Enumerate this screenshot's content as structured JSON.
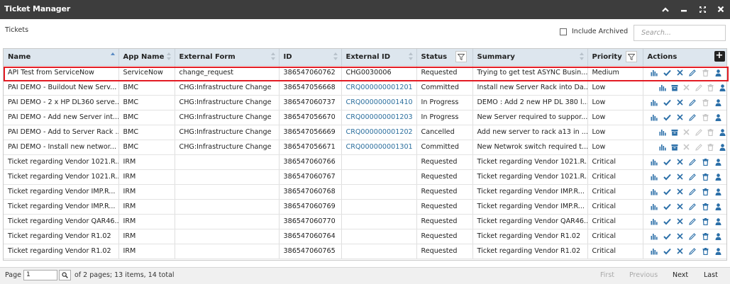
{
  "window": {
    "title": "Ticket Manager"
  },
  "section": {
    "label": "Tickets"
  },
  "toolbar": {
    "include_archived_label": "Include Archived",
    "include_archived_checked": false,
    "search_placeholder": "Search..."
  },
  "columns": [
    "Name",
    "App Name",
    "External Form",
    "ID",
    "External ID",
    "Status",
    "Summary",
    "Priority",
    "Actions"
  ],
  "rows": [
    {
      "name": "API Test from ServiceNow",
      "app": "ServiceNow",
      "form": "change_request",
      "id": "386547060762",
      "ext_id": "CHG0030006",
      "status": "Requested",
      "summary": "Trying to get test ASYNC Busin...",
      "priority": "Medium",
      "icons": [
        "chart",
        "check",
        "x",
        "pencil",
        "trash-disabled",
        "user"
      ]
    },
    {
      "name": "PAI DEMO - Buildout New Serv...",
      "app": "BMC",
      "form": "CHG:Infrastructure Change",
      "id": "386547056668",
      "ext_id": "CRQ000000001201",
      "status": "Committed",
      "summary": "Install new Server Rack into Da...",
      "priority": "Low",
      "icons": [
        "chart",
        "archive",
        "x-disabled",
        "pencil-disabled",
        "trash-disabled",
        "user"
      ]
    },
    {
      "name": "PAI DEMO - 2 x HP DL360 serve...",
      "app": "BMC",
      "form": "CHG:Infrastructure Change",
      "id": "386547060737",
      "ext_id": "CRQ000000001410",
      "status": "In Progress",
      "summary": "DEMO : Add 2 new HP DL 380 l...",
      "priority": "Low",
      "icons": [
        "chart",
        "check",
        "x",
        "pencil",
        "trash-disabled",
        "user"
      ]
    },
    {
      "name": "PAI DEMO - Add new Server int...",
      "app": "BMC",
      "form": "CHG:Infrastructure Change",
      "id": "386547056670",
      "ext_id": "CRQ000000001203",
      "status": "In Progress",
      "summary": "New Server required to suppor...",
      "priority": "Low",
      "icons": [
        "chart",
        "check",
        "x",
        "pencil",
        "trash-disabled",
        "user"
      ]
    },
    {
      "name": "PAI DEMO - Add to Server Rack ...",
      "app": "BMC",
      "form": "CHG:Infrastructure Change",
      "id": "386547056669",
      "ext_id": "CRQ000000001202",
      "status": "Cancelled",
      "summary": "Add new server to rack a13 in ...",
      "priority": "Low",
      "icons": [
        "chart",
        "archive",
        "x-disabled",
        "pencil-disabled",
        "trash-disabled",
        "user"
      ]
    },
    {
      "name": "PAI DEMO - Install new networ...",
      "app": "BMC",
      "form": "CHG:Infrastructure Change",
      "id": "386547056671",
      "ext_id": "CRQ000000001301",
      "status": "Committed",
      "summary": "New Netwrok switch required t...",
      "priority": "Low",
      "icons": [
        "chart",
        "archive",
        "x-disabled",
        "pencil-disabled",
        "trash-disabled",
        "user"
      ]
    },
    {
      "name": "Ticket regarding Vendor 1021.R...",
      "app": "IRM",
      "form": "",
      "id": "386547060766",
      "ext_id": "",
      "status": "Requested",
      "summary": "Ticket regarding Vendor 1021.R...",
      "priority": "Critical",
      "icons": [
        "chart",
        "check",
        "x",
        "pencil",
        "trash",
        "user"
      ]
    },
    {
      "name": "Ticket regarding Vendor 1021.R...",
      "app": "IRM",
      "form": "",
      "id": "386547060767",
      "ext_id": "",
      "status": "Requested",
      "summary": "Ticket regarding Vendor 1021.R...",
      "priority": "Critical",
      "icons": [
        "chart",
        "check",
        "x",
        "pencil",
        "trash",
        "user"
      ]
    },
    {
      "name": "Ticket regarding Vendor IMP.R...",
      "app": "IRM",
      "form": "",
      "id": "386547060768",
      "ext_id": "",
      "status": "Requested",
      "summary": "Ticket regarding Vendor IMP.R...",
      "priority": "Critical",
      "icons": [
        "chart",
        "check",
        "x",
        "pencil",
        "trash",
        "user"
      ]
    },
    {
      "name": "Ticket regarding Vendor IMP.R...",
      "app": "IRM",
      "form": "",
      "id": "386547060769",
      "ext_id": "",
      "status": "Requested",
      "summary": "Ticket regarding Vendor IMP.R...",
      "priority": "Critical",
      "icons": [
        "chart",
        "check",
        "x",
        "pencil",
        "trash",
        "user"
      ]
    },
    {
      "name": "Ticket regarding Vendor QAR46...",
      "app": "IRM",
      "form": "",
      "id": "386547060770",
      "ext_id": "",
      "status": "Requested",
      "summary": "Ticket regarding Vendor QAR46...",
      "priority": "Critical",
      "icons": [
        "chart",
        "check",
        "x",
        "pencil",
        "trash",
        "user"
      ]
    },
    {
      "name": "Ticket regarding Vendor R1.02",
      "app": "IRM",
      "form": "",
      "id": "386547060764",
      "ext_id": "",
      "status": "Requested",
      "summary": "Ticket regarding Vendor R1.02",
      "priority": "Critical",
      "icons": [
        "chart",
        "check",
        "x",
        "pencil",
        "trash",
        "user"
      ]
    },
    {
      "name": "Ticket regarding Vendor R1.02",
      "app": "IRM",
      "form": "",
      "id": "386547060765",
      "ext_id": "",
      "status": "Requested",
      "summary": "Ticket regarding Vendor R1.02",
      "priority": "Critical",
      "icons": [
        "chart",
        "check",
        "x",
        "pencil",
        "trash",
        "user"
      ]
    }
  ],
  "pagination": {
    "page_label": "Page",
    "page_value": "1",
    "info": "of 2 pages; 13 items, 14 total",
    "first": "First",
    "previous": "Previous",
    "next": "Next",
    "last": "Last"
  },
  "colors": {
    "titlebar": "#3d3d3d",
    "header": "#dde6ee",
    "link": "#2c6f9e",
    "icon": "#2b6fa8",
    "highlight": "#e31b23"
  }
}
